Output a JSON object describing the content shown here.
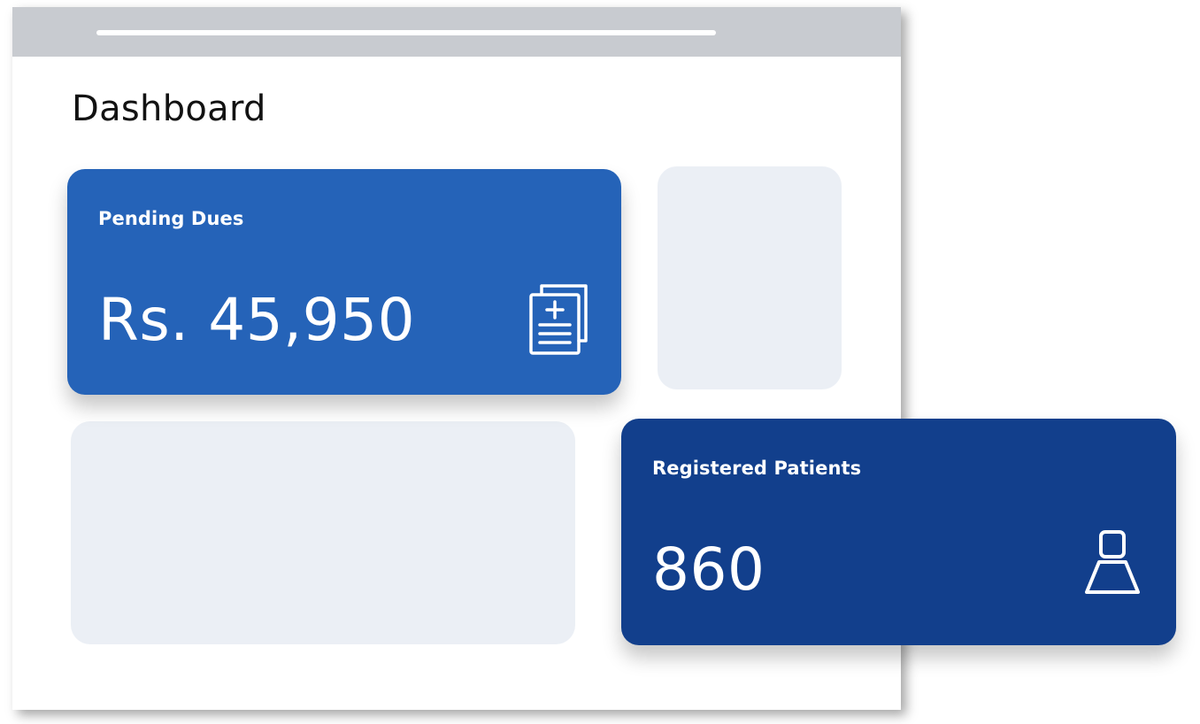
{
  "page": {
    "title": "Dashboard"
  },
  "cards": {
    "pending_dues": {
      "label": "Pending Dues",
      "value": "Rs. 45,950",
      "icon": "medical-documents-icon",
      "color": "#2563b8"
    },
    "registered_patients": {
      "label": "Registered Patients",
      "value": "860",
      "icon": "user-icon",
      "color": "#123f8c"
    }
  },
  "colors": {
    "titlebar": "#c8cbd0",
    "placeholder": "#ebeff5"
  }
}
